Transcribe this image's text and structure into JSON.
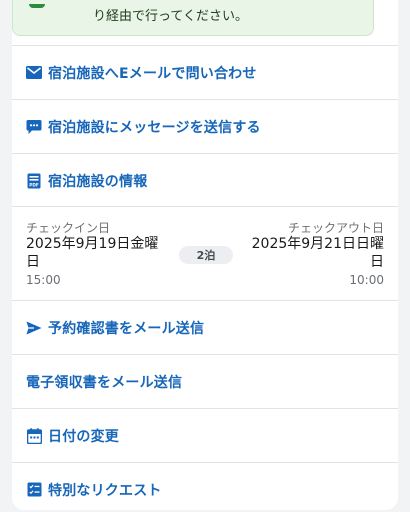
{
  "notice": {
    "text": "り経由で行ってください。"
  },
  "actions": [
    {
      "label": "宿泊施設へEメールで問い合わせ",
      "icon": "envelope-icon"
    },
    {
      "label": "宿泊施設にメッセージを送信する",
      "icon": "chat-bubble-icon"
    },
    {
      "label": "宿泊施設の情報",
      "icon": "pdf-document-icon"
    }
  ],
  "stay": {
    "checkin_caption": "チェックイン日",
    "checkin_date_line1": "2025年9月19日金曜",
    "checkin_date_line2": "日",
    "checkin_time": "15:00",
    "nights": "2泊",
    "checkout_caption": "チェックアウト日",
    "checkout_date_line1": "2025年9月21日日曜",
    "checkout_date_line2": "日",
    "checkout_time": "10:00"
  },
  "more_actions": [
    {
      "label": "予約確認書をメール送信",
      "icon": "send-arrow-icon"
    },
    {
      "label": "電子領収書をメール送信",
      "icon": ""
    },
    {
      "label": "日付の変更",
      "icon": "calendar-icon"
    },
    {
      "label": "特別なリクエスト",
      "icon": "checklist-icon"
    }
  ],
  "colors": {
    "link": "#1766b9",
    "notice_bg": "#e9f5e6",
    "accent_green": "#2e8b3e"
  }
}
